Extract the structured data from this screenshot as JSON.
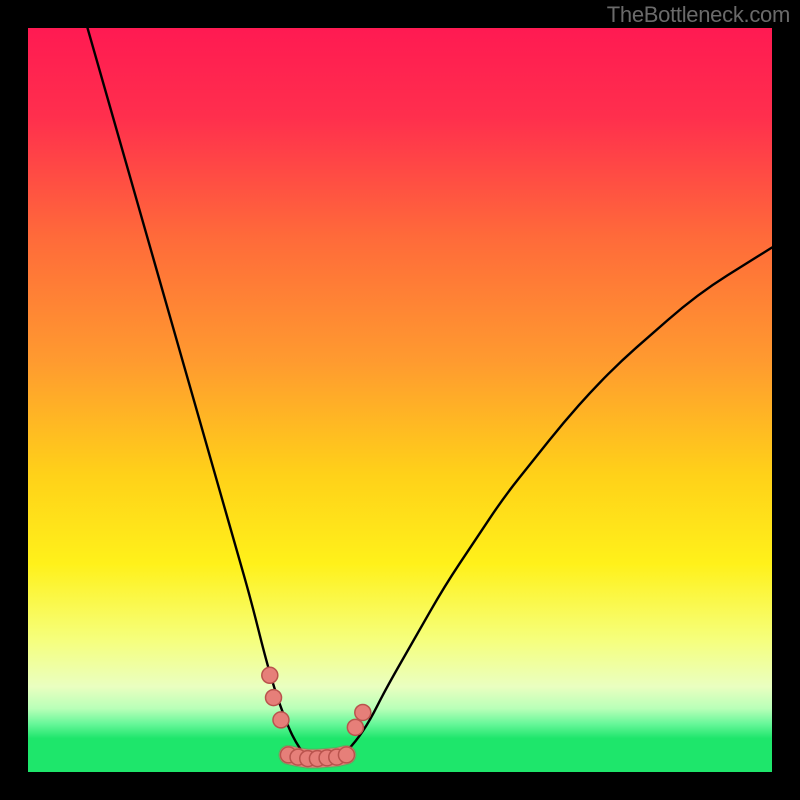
{
  "watermark": "TheBottleneck.com",
  "colors": {
    "black": "#000000",
    "curve": "#000000",
    "pink_marker_fill": "#e67f79",
    "pink_marker_stroke": "#b9534d",
    "green_band": "#1ee66b"
  },
  "chart_data": {
    "type": "line",
    "title": "",
    "xlabel": "",
    "ylabel": "",
    "xlim": [
      0,
      100
    ],
    "ylim": [
      0,
      100
    ],
    "grid": false,
    "legend": false,
    "gradient_stops": [
      {
        "pos": 0.0,
        "color": "#ff1a52"
      },
      {
        "pos": 0.12,
        "color": "#ff2f4d"
      },
      {
        "pos": 0.28,
        "color": "#ff6a3a"
      },
      {
        "pos": 0.45,
        "color": "#ff9b2f"
      },
      {
        "pos": 0.6,
        "color": "#ffd119"
      },
      {
        "pos": 0.72,
        "color": "#fff11a"
      },
      {
        "pos": 0.82,
        "color": "#f6ff7a"
      },
      {
        "pos": 0.885,
        "color": "#eaffc0"
      },
      {
        "pos": 0.915,
        "color": "#b8ffb8"
      },
      {
        "pos": 0.935,
        "color": "#68f79a"
      },
      {
        "pos": 0.955,
        "color": "#1ee66b"
      },
      {
        "pos": 1.0,
        "color": "#1ee66b"
      }
    ],
    "series": [
      {
        "name": "left-curve",
        "x": [
          8,
          10,
          12,
          14,
          16,
          18,
          20,
          22,
          24,
          26,
          28,
          30,
          32,
          33.5,
          35,
          36,
          37,
          38
        ],
        "y": [
          100,
          93,
          86,
          79,
          72,
          65,
          58,
          51,
          44,
          37,
          30,
          23,
          15,
          10,
          6,
          4,
          2.5,
          2
        ]
      },
      {
        "name": "right-curve",
        "x": [
          42,
          44,
          46,
          48,
          52,
          56,
          60,
          64,
          68,
          72,
          76,
          80,
          84,
          88,
          92,
          96,
          100
        ],
        "y": [
          2,
          4,
          7,
          11,
          18,
          25,
          31,
          37,
          42,
          47,
          51.5,
          55.5,
          59,
          62.5,
          65.5,
          68,
          70.5
        ]
      }
    ],
    "trough_markers": {
      "left_cluster": [
        {
          "x": 32.5,
          "y": 13
        },
        {
          "x": 33.0,
          "y": 10
        },
        {
          "x": 34.0,
          "y": 7
        }
      ],
      "right_cluster": [
        {
          "x": 44.0,
          "y": 6
        },
        {
          "x": 45.0,
          "y": 8
        }
      ],
      "bottom_band": [
        {
          "x": 35.0,
          "y": 2.3
        },
        {
          "x": 36.3,
          "y": 2.0
        },
        {
          "x": 37.6,
          "y": 1.8
        },
        {
          "x": 38.9,
          "y": 1.8
        },
        {
          "x": 40.2,
          "y": 1.9
        },
        {
          "x": 41.5,
          "y": 2.0
        },
        {
          "x": 42.8,
          "y": 2.3
        }
      ]
    }
  }
}
